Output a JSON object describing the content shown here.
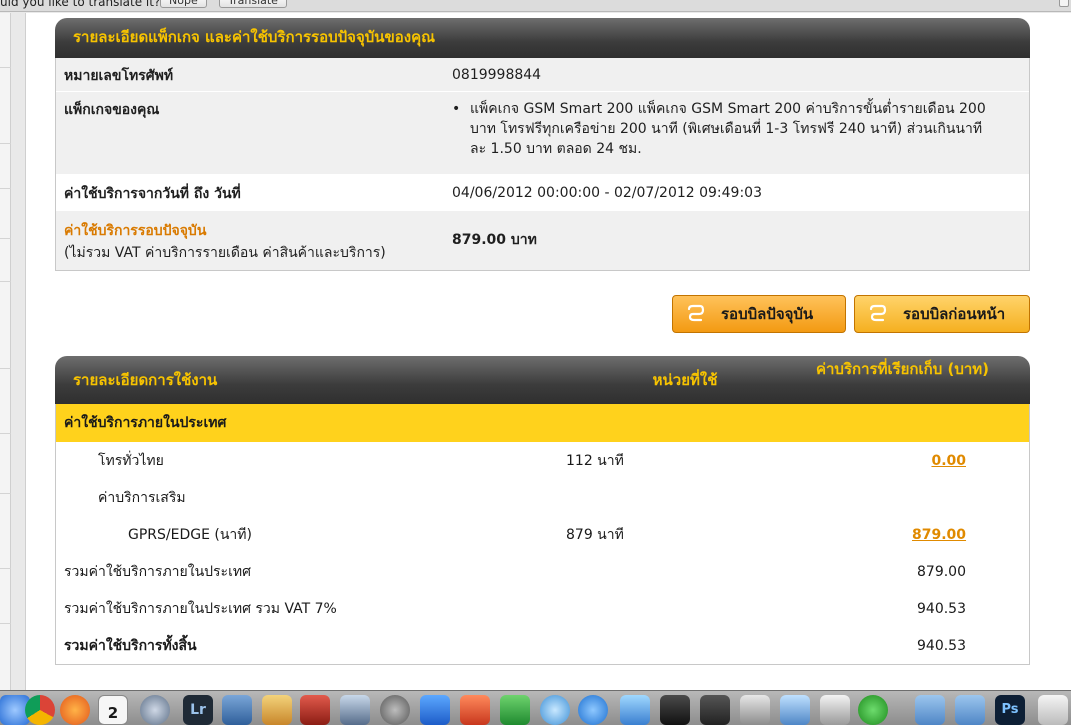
{
  "translate_bar": {
    "text": "uld you like to translate it?",
    "nope_label": "Nope",
    "translate_label": "Translate"
  },
  "package_panel": {
    "title": "รายละเอียดแพ็กเกจ และค่าใช้บริการรอบปัจจุบันของคุณ",
    "phone_label": "หมายเลขโทรศัพท์",
    "phone_value": "0819998844",
    "package_label": "แพ็กเกจของคุณ",
    "package_bullet": "•",
    "package_value": "แพ็คเกจ GSM Smart 200 แพ็คเกจ GSM Smart 200 ค่าบริการขั้นต่ำรายเดือน 200 บาท โทรฟรีทุกเครือข่าย 200 นาที (พิเศษเดือนที่ 1-3 โทรฟรี 240 นาที) ส่วนเกินนาทีละ 1.50 บาท ตลอด 24 ชม.",
    "period_label": "ค่าใช้บริการจากวันที่ ถึง วันที่",
    "period_value": "04/06/2012 00:00:00 - 02/07/2012 09:49:03",
    "current_charge_label": "ค่าใช้บริการรอบปัจจุบัน",
    "current_charge_note": "(ไม่รวม VAT ค่าบริการรายเดือน ค่าสินค้าและบริการ)",
    "current_charge_value": "879.00 บาท"
  },
  "buttons": {
    "current_bill": "รอบบิลปัจจุบัน",
    "previous_bill": "รอบบิลก่อนหน้า"
  },
  "usage_panel": {
    "col_detail": "รายละเอียดการใช้งาน",
    "col_units": "หน่วยที่ใช้",
    "col_charge": "ค่าบริการที่เรียกเก็บ (บาท)",
    "category": "ค่าใช้บริการภายในประเทศ",
    "rows": [
      {
        "label": "โทรทั่วไทย",
        "units": "112 นาที",
        "amount": "0.00"
      },
      {
        "label": "ค่าบริการเสริม",
        "units": "",
        "amount": ""
      },
      {
        "label": "GPRS/EDGE (นาที)",
        "units": "879 นาที",
        "amount": "879.00"
      }
    ],
    "subtotal_label": "รวมค่าใช้บริการภายในประเทศ",
    "subtotal_value": "879.00",
    "vat_label": "รวมค่าใช้บริการภายในประเทศ รวม VAT 7%",
    "vat_value": "940.53",
    "total_label": "รวมค่าใช้บริการทั้งสิ้น",
    "total_value": "940.53"
  },
  "dock": {
    "calendar_day": "2",
    "lr_label": "Lr",
    "ps_label": "Ps"
  },
  "colors": {
    "header_text": "#f7c300",
    "accent_orange": "#d97a00",
    "category_yellow": "#ffd21c",
    "button_orange": "#f39a12"
  }
}
